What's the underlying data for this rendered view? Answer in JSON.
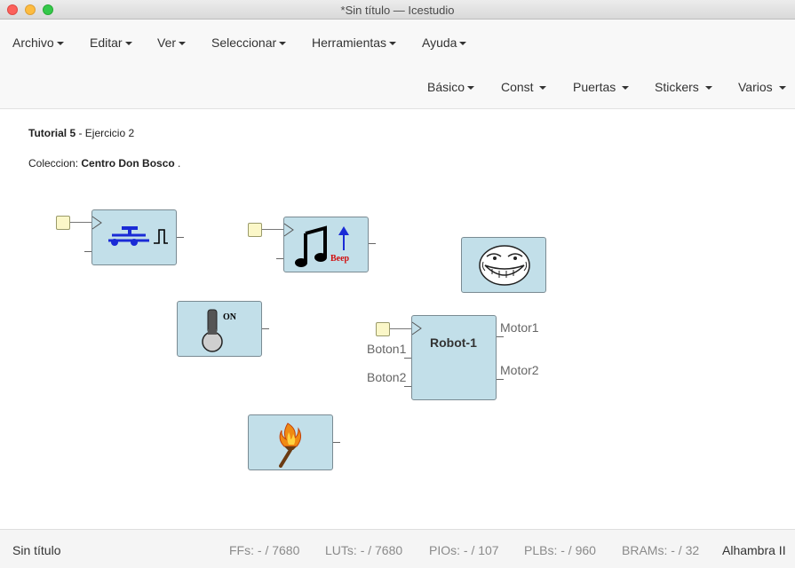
{
  "window": {
    "title": "*Sin título — Icestudio"
  },
  "menu": {
    "top": [
      {
        "label": "Archivo"
      },
      {
        "label": "Editar"
      },
      {
        "label": "Ver"
      },
      {
        "label": "Seleccionar"
      },
      {
        "label": "Herramientas"
      },
      {
        "label": "Ayuda"
      }
    ],
    "blocks": [
      {
        "label": "Básico"
      },
      {
        "label": "Const"
      },
      {
        "label": "Puertas"
      },
      {
        "label": "Stickers"
      },
      {
        "label": "Varios"
      }
    ]
  },
  "canvas": {
    "tutorial_bold": "Tutorial 5",
    "tutorial_rest": " - Ejercicio 2",
    "coleccion_prefix": "Coleccion: ",
    "coleccion_name": "Centro Don Bosco",
    "coleccion_suffix": " .",
    "robot": {
      "title": "Robot-1",
      "inputs": [
        "Boton1",
        "Boton2"
      ],
      "outputs": [
        "Motor1",
        "Motor2"
      ]
    },
    "beep_label": "Beep",
    "switch_label": "ON",
    "icons": [
      "button-pulse-icon",
      "music-beep-icon",
      "troll-face-icon",
      "toggle-switch-icon",
      "torch-icon"
    ]
  },
  "status": {
    "project": "Sin título",
    "ffs_label": "FFs:",
    "ffs_value": "- / 7680",
    "luts_label": "LUTs:",
    "luts_value": "- / 7680",
    "pios_label": "PIOs:",
    "pios_value": "- / 107",
    "plbs_label": "PLBs:",
    "plbs_value": "- / 960",
    "brams_label": "BRAMs:",
    "brams_value": "- / 32",
    "board": "Alhambra II"
  },
  "colors": {
    "block_fill": "#c2dfe9",
    "input_node": "#fbf7c8",
    "menubar": "#f8f8f8"
  }
}
